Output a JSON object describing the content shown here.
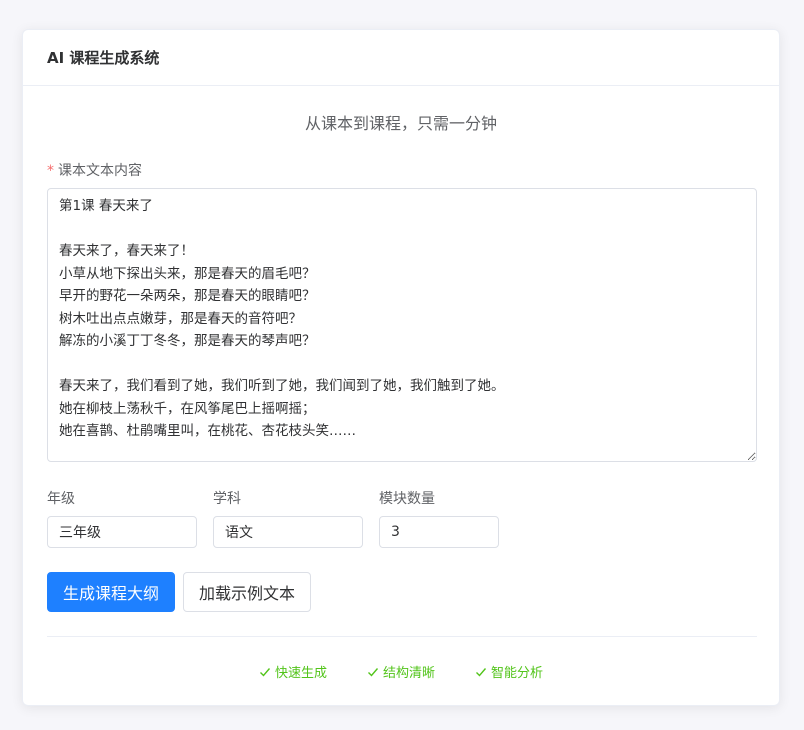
{
  "header": {
    "title": "AI 课程生成系统"
  },
  "subtitle": "从课本到课程，只需一分钟",
  "form": {
    "content_label": "课本文本内容",
    "required_mark": "*",
    "content_value": "第1课 春天来了\n\n春天来了，春天来了！\n小草从地下探出头来，那是春天的眉毛吧？\n早开的野花一朵两朵，那是春天的眼睛吧？\n树木吐出点点嫩芽，那是春天的音符吧？\n解冻的小溪丁丁冬冬，那是春天的琴声吧？\n\n春天来了，我们看到了她，我们听到了她，我们闻到了她，我们触到了她。\n她在柳枝上荡秋千，在风筝尾巴上摇啊摇；\n她在喜鹊、杜鹃嘴里叫，在桃花、杏花枝头笑……",
    "grade_label": "年级",
    "grade_value": "三年级",
    "subject_label": "学科",
    "subject_value": "语文",
    "modules_label": "模块数量",
    "modules_value": "3"
  },
  "buttons": {
    "generate": "生成课程大纲",
    "load_example": "加载示例文本"
  },
  "features": [
    {
      "label": "快速生成",
      "icon": "check-icon"
    },
    {
      "label": "结构清晰",
      "icon": "check-icon"
    },
    {
      "label": "智能分析",
      "icon": "check-icon"
    }
  ],
  "colors": {
    "primary": "#1e80ff",
    "success": "#52c41a",
    "required": "#f56c6c"
  }
}
